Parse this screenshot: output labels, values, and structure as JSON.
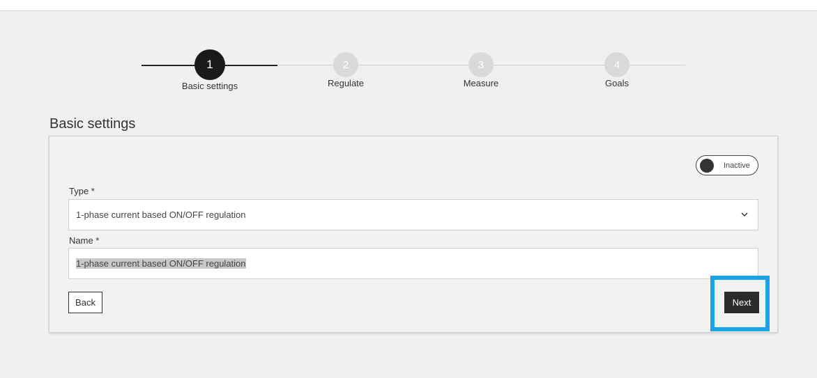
{
  "stepper": {
    "steps": [
      {
        "number": "1",
        "label": "Basic settings",
        "state": "active"
      },
      {
        "number": "2",
        "label": "Regulate",
        "state": "inactive"
      },
      {
        "number": "3",
        "label": "Measure",
        "state": "inactive"
      },
      {
        "number": "4",
        "label": "Goals",
        "state": "inactive"
      }
    ]
  },
  "section": {
    "title": "Basic settings"
  },
  "form": {
    "status_toggle": {
      "label": "Inactive",
      "active": false
    },
    "type": {
      "label": "Type *",
      "value": "1-phase current based ON/OFF regulation"
    },
    "name": {
      "label": "Name *",
      "value": "1-phase current based ON/OFF regulation"
    },
    "back_label": "Back",
    "next_label": "Next"
  },
  "colors": {
    "accent_highlight": "#1ba3e8",
    "active_step": "#1a1a1a",
    "inactive_step": "#d9d9d9",
    "primary_button": "#2b2b2b"
  }
}
